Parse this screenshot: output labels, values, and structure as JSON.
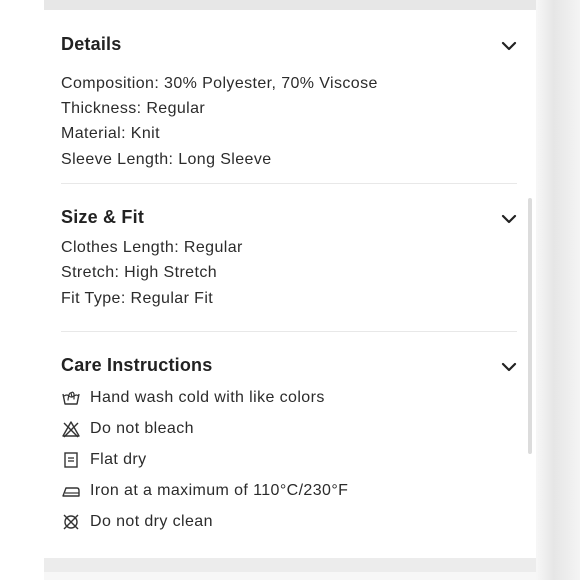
{
  "details": {
    "title": "Details",
    "lines": [
      "Composition: 30% Polyester, 70% Viscose",
      "Thickness: Regular",
      "Material: Knit",
      "Sleeve Length: Long Sleeve"
    ]
  },
  "size_fit": {
    "title": "Size & Fit",
    "lines": [
      "Clothes Length: Regular",
      "Stretch: High Stretch",
      "Fit Type: Regular Fit"
    ]
  },
  "care": {
    "title": "Care Instructions",
    "items": [
      {
        "icon": "hand-wash-icon",
        "text": "Hand wash cold with like colors"
      },
      {
        "icon": "no-bleach-icon",
        "text": "Do not bleach"
      },
      {
        "icon": "flat-dry-icon",
        "text": "Flat dry"
      },
      {
        "icon": "iron-icon",
        "text": "Iron at a maximum of 110°C/230°F"
      },
      {
        "icon": "no-dry-clean-icon",
        "text": "Do not dry clean"
      }
    ]
  },
  "colors": {
    "text": "#2b2b2b",
    "title": "#222222",
    "divider": "#e8e8e8"
  }
}
